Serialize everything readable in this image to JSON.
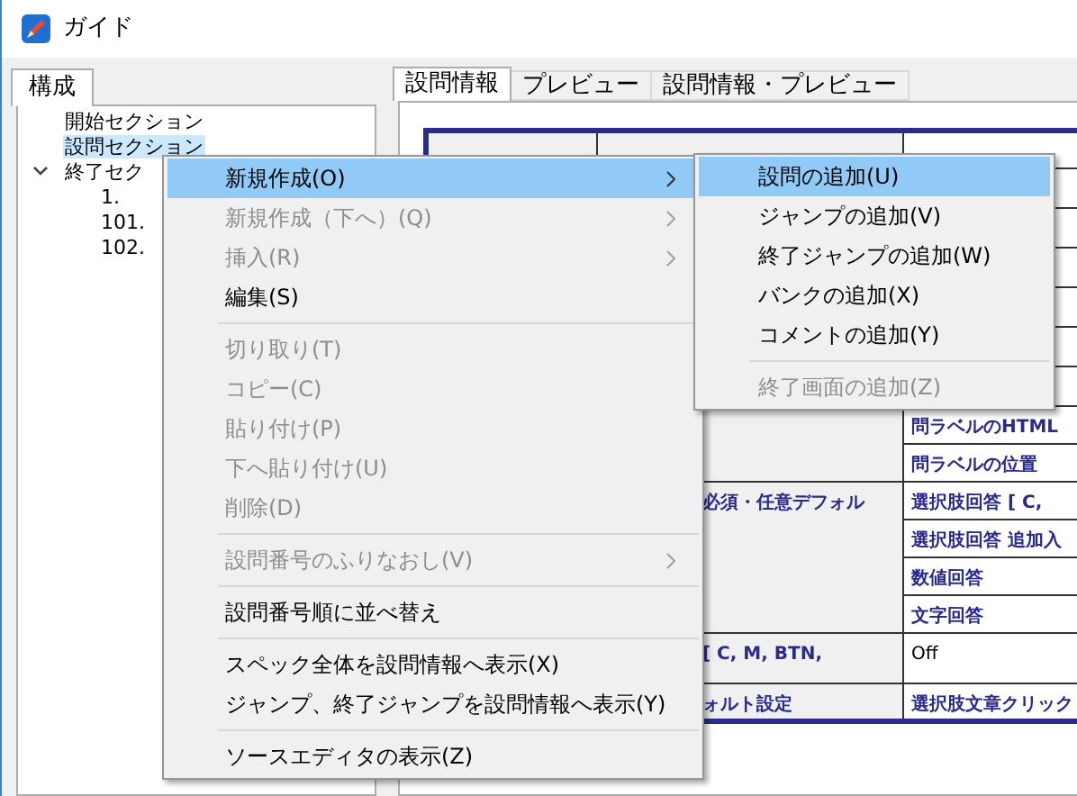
{
  "window": {
    "title": "ガイド"
  },
  "left_tabs": [
    {
      "label": "構成",
      "selected": true
    }
  ],
  "tree": [
    {
      "label": "開始セクション",
      "selected": false,
      "expanded": false
    },
    {
      "label": "設問セクション",
      "selected": true,
      "expanded": false
    },
    {
      "label": "終了セク",
      "selected": false,
      "expanded": true,
      "children": [
        {
          "label": "1.",
          "selected": false,
          "expanded": false
        },
        {
          "label": "101.",
          "selected": false,
          "expanded": false
        },
        {
          "label": "102.",
          "selected": false,
          "expanded": false
        }
      ]
    }
  ],
  "right_tabs": [
    {
      "label": "設問情報",
      "selected": true
    },
    {
      "label": "プレビュー",
      "selected": false
    },
    {
      "label": "設問情報・プレビュー",
      "selected": false
    }
  ],
  "table": {
    "rows": [
      [
        {
          "kind": "label"
        },
        {
          "kind": "label"
        },
        {
          "kind": "value"
        }
      ],
      [
        {
          "kind": "label",
          "rowspan": 14
        },
        {
          "kind": "label",
          "rowspan": 8
        },
        {
          "kind": "value"
        }
      ],
      [
        {
          "kind": "value"
        }
      ],
      [
        {
          "kind": "value"
        }
      ],
      [
        {
          "kind": "value"
        }
      ],
      [
        {
          "kind": "value"
        }
      ],
      [
        {
          "kind": "value"
        }
      ],
      [
        {
          "text": "問ラベルのHTML",
          "kind": "label"
        }
      ],
      [
        {
          "text": "問ラベルの位置",
          "kind": "label"
        }
      ],
      [
        {
          "text": "必須・任意デフォル",
          "kind": "label",
          "rowspan": 4
        },
        {
          "text": "選択肢回答 [ C,",
          "kind": "label"
        }
      ],
      [
        {
          "text": "選択肢回答 追加入",
          "kind": "label"
        }
      ],
      [
        {
          "text": "数値回答",
          "kind": "label"
        }
      ],
      [
        {
          "text": "文字回答",
          "kind": "label"
        }
      ],
      [
        {
          "text": "[ C, M, BTN,",
          "kind": "label"
        },
        {
          "text": "Off",
          "kind": "value"
        }
      ],
      [
        {
          "text": "ォルト設定",
          "kind": "label"
        },
        {
          "text": "選択肢文章クリック",
          "kind": "label"
        }
      ]
    ]
  },
  "context_menu": {
    "items": [
      {
        "kind": "item",
        "label": "新規作成(O)",
        "disabled": false,
        "submenu": true,
        "selected": true
      },
      {
        "kind": "item",
        "label": "新規作成（下へ）(Q)",
        "disabled": true,
        "submenu": true,
        "selected": false
      },
      {
        "kind": "item",
        "label": "挿入(R)",
        "disabled": true,
        "submenu": true,
        "selected": false
      },
      {
        "kind": "item",
        "label": "編集(S)",
        "disabled": false,
        "submenu": false,
        "selected": false
      },
      {
        "kind": "separator"
      },
      {
        "kind": "item",
        "label": "切り取り(T)",
        "disabled": true,
        "submenu": false,
        "selected": false
      },
      {
        "kind": "item",
        "label": "コピー(C)",
        "disabled": true,
        "submenu": false,
        "selected": false
      },
      {
        "kind": "item",
        "label": "貼り付け(P)",
        "disabled": true,
        "submenu": false,
        "selected": false
      },
      {
        "kind": "item",
        "label": "下へ貼り付け(U)",
        "disabled": true,
        "submenu": false,
        "selected": false
      },
      {
        "kind": "item",
        "label": "削除(D)",
        "disabled": true,
        "submenu": false,
        "selected": false
      },
      {
        "kind": "separator"
      },
      {
        "kind": "item",
        "label": "設問番号のふりなおし(V)",
        "disabled": true,
        "submenu": true,
        "selected": false
      },
      {
        "kind": "separator"
      },
      {
        "kind": "item",
        "label": "設問番号順に並べ替え",
        "disabled": false,
        "submenu": false,
        "selected": false
      },
      {
        "kind": "separator"
      },
      {
        "kind": "item",
        "label": "スペック全体を設問情報へ表示(X)",
        "disabled": false,
        "submenu": false,
        "selected": false
      },
      {
        "kind": "item",
        "label": "ジャンプ、終了ジャンプを設問情報へ表示(Y)",
        "disabled": false,
        "submenu": false,
        "selected": false
      },
      {
        "kind": "separator"
      },
      {
        "kind": "item",
        "label": "ソースエディタの表示(Z)",
        "disabled": false,
        "submenu": false,
        "selected": false
      }
    ]
  },
  "submenu": {
    "items": [
      {
        "kind": "item",
        "label": "設問の追加(U)",
        "disabled": false,
        "selected": true
      },
      {
        "kind": "item",
        "label": "ジャンプの追加(V)",
        "disabled": false,
        "selected": false
      },
      {
        "kind": "item",
        "label": "終了ジャンプの追加(W)",
        "disabled": false,
        "selected": false
      },
      {
        "kind": "item",
        "label": "バンクの追加(X)",
        "disabled": false,
        "selected": false
      },
      {
        "kind": "item",
        "label": "コメントの追加(Y)",
        "disabled": false,
        "selected": false
      },
      {
        "kind": "separator"
      },
      {
        "kind": "item",
        "label": "終了画面の追加(Z)",
        "disabled": true,
        "selected": false
      }
    ]
  }
}
